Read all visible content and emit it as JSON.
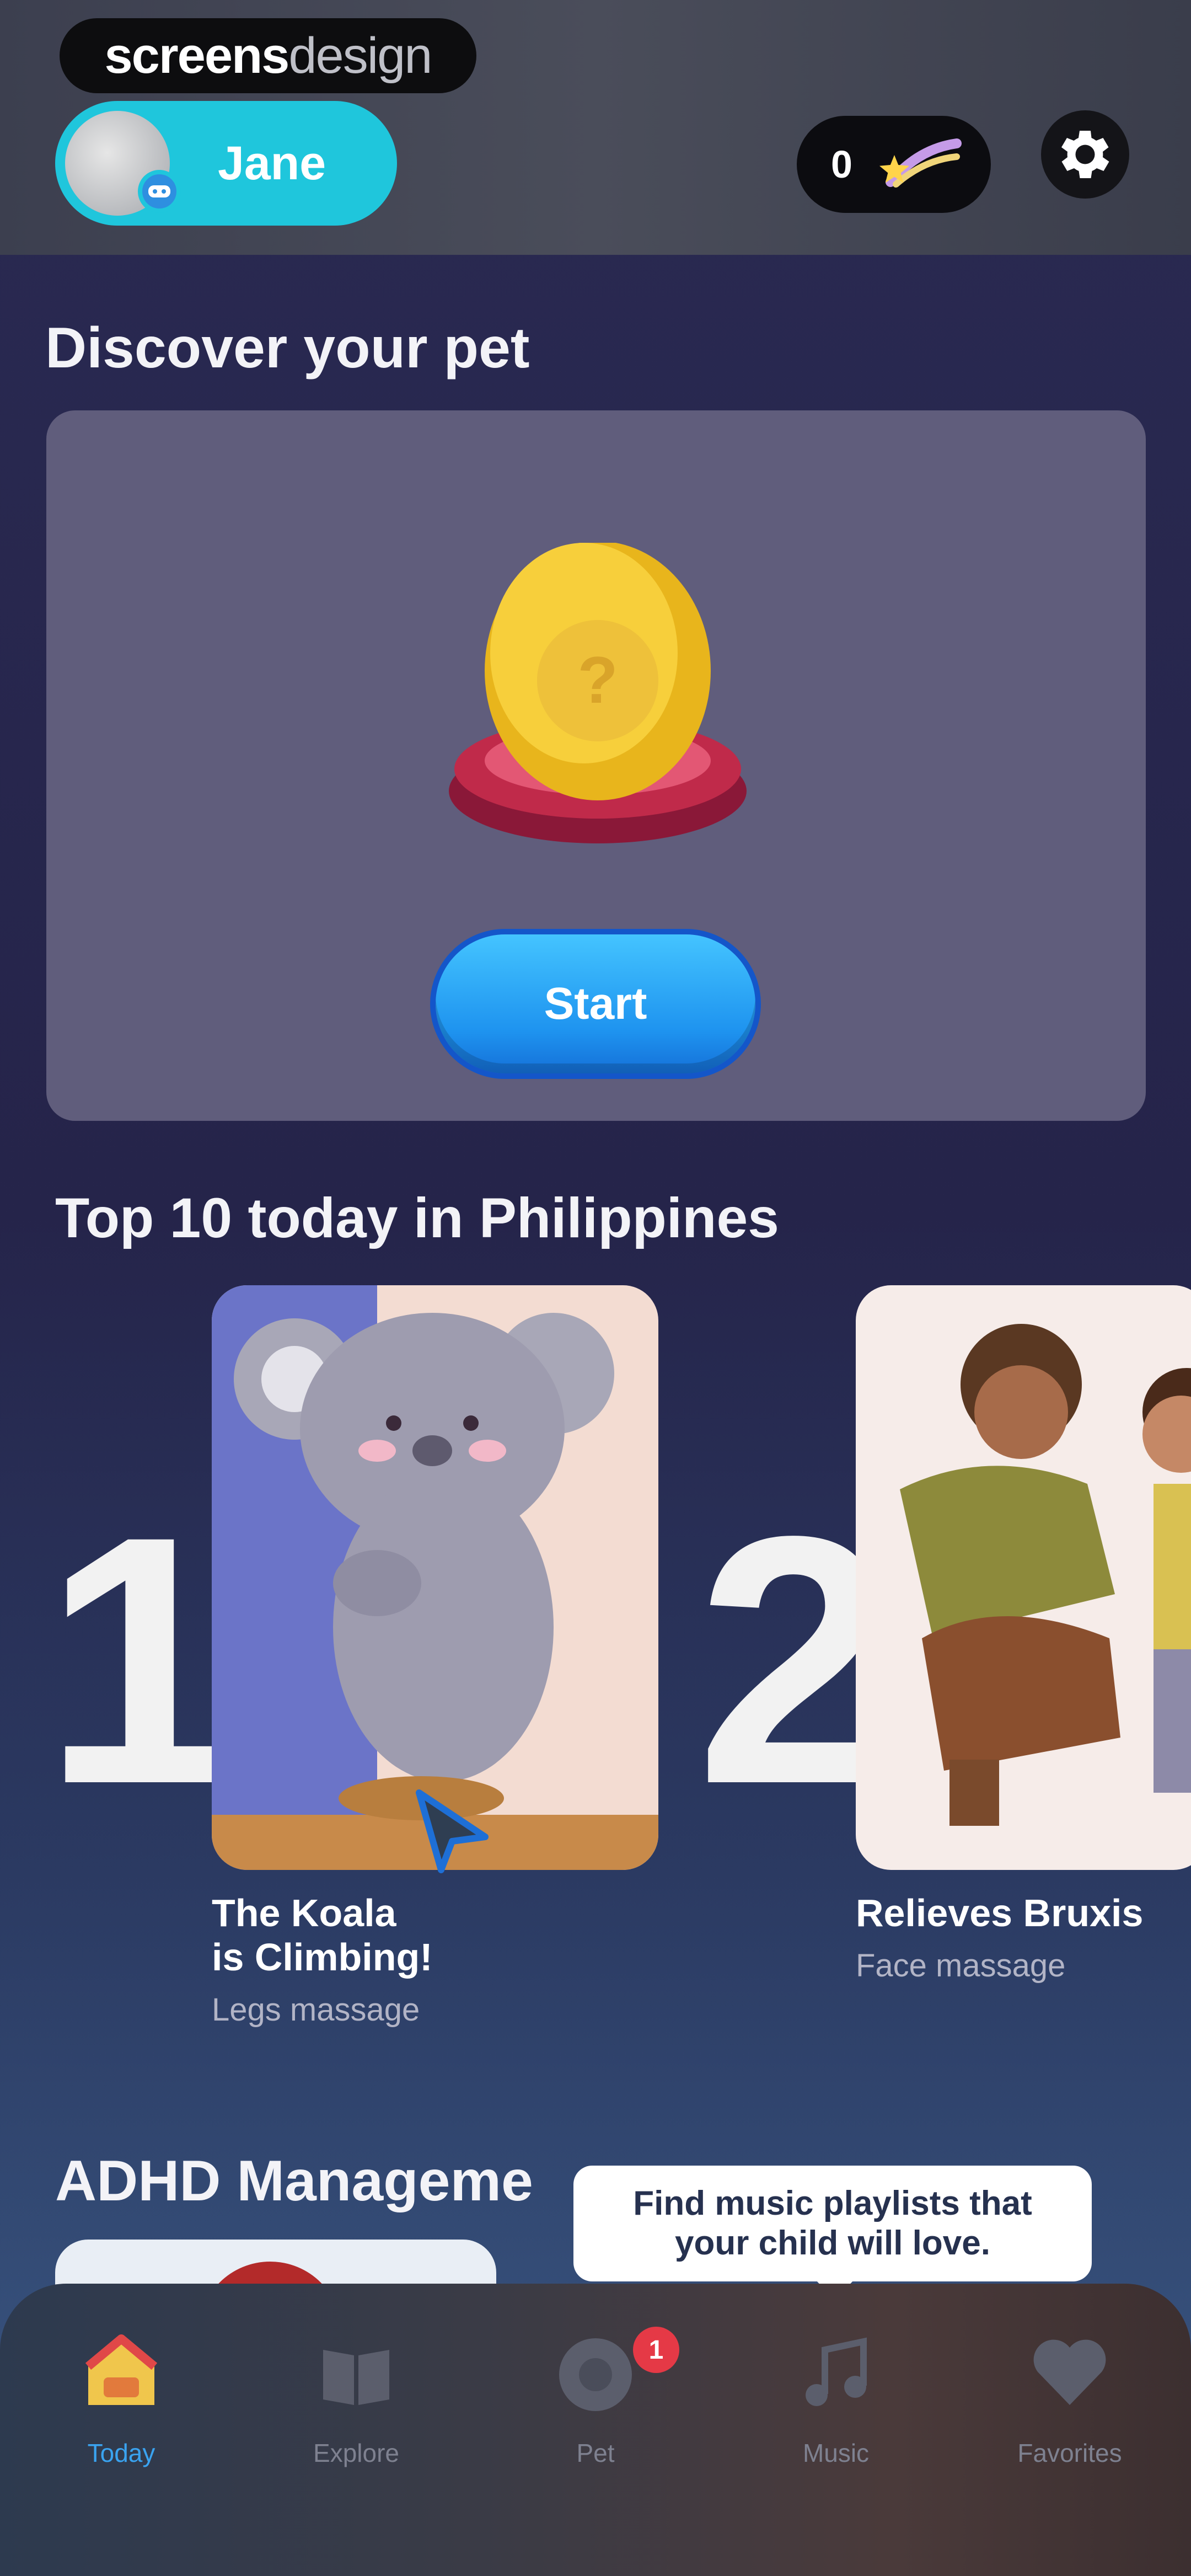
{
  "watermark": {
    "part1": "screens",
    "part2": "design"
  },
  "profile": {
    "name": "Jane"
  },
  "coins": {
    "count": "0",
    "icon": "comet-icon"
  },
  "settings": {
    "icon": "gear-icon"
  },
  "discover": {
    "title": "Discover your pet",
    "start_label": "Start",
    "egg_mark": "?"
  },
  "top10": {
    "title": "Top 10 today in Philippines",
    "items": [
      {
        "rank": "1",
        "title_line1": "The Koala",
        "title_line2": "is Climbing!",
        "subtitle": "Legs massage"
      },
      {
        "rank": "2",
        "title_line1": "Relieves Bruxis",
        "title_line2": "",
        "subtitle": "Face massage"
      }
    ]
  },
  "adhd": {
    "title": "ADHD Manageme"
  },
  "tooltip": {
    "text": "Find music playlists that your child will love."
  },
  "tabs": [
    {
      "label": "Today",
      "icon": "home-icon",
      "active": true
    },
    {
      "label": "Explore",
      "icon": "book-icon",
      "active": false
    },
    {
      "label": "Pet",
      "icon": "pet-icon",
      "active": false,
      "badge": "1"
    },
    {
      "label": "Music",
      "icon": "music-note-icon",
      "active": false
    },
    {
      "label": "Favorites",
      "icon": "heart-icon",
      "active": false
    }
  ],
  "colors": {
    "accent_cyan": "#1fc6dc",
    "start_blue": "#1e93ef",
    "active_tab": "#3aa3f0",
    "badge_red": "#e53946"
  }
}
